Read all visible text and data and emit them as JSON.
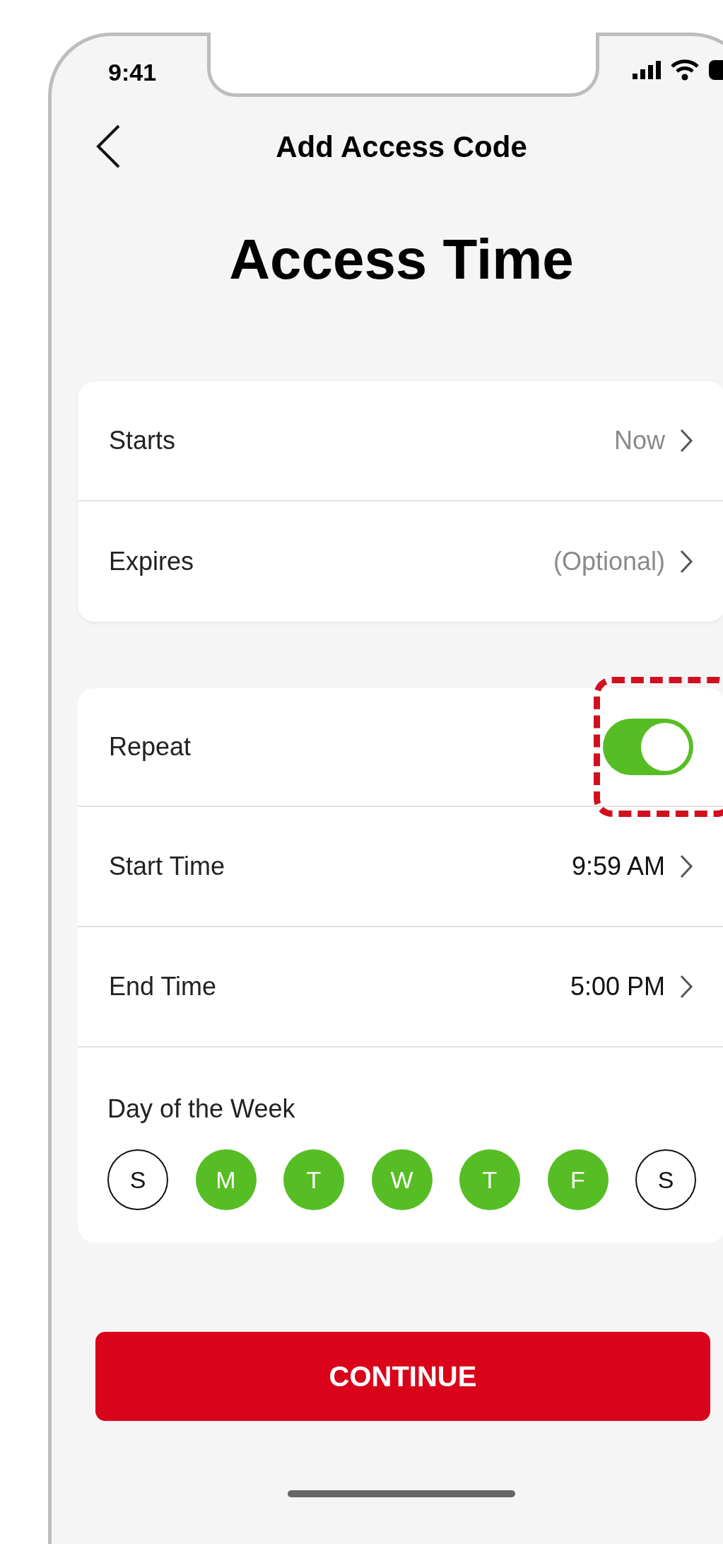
{
  "status_bar": {
    "time": "9:41"
  },
  "header": {
    "title": "Add Access Code"
  },
  "heading": "Access Time",
  "schedule": [
    {
      "label": "Starts",
      "value": "Now",
      "kind": "hint"
    },
    {
      "label": "Expires",
      "value": "(Optional)",
      "kind": "hint"
    }
  ],
  "repeat": {
    "label": "Repeat",
    "on": true
  },
  "times": [
    {
      "label": "Start Time",
      "value": "9:59 AM",
      "kind": "value"
    },
    {
      "label": "End Time",
      "value": "5:00 PM",
      "kind": "value"
    }
  ],
  "days": {
    "label": "Day of the Week",
    "items": [
      {
        "letter": "S",
        "selected": false
      },
      {
        "letter": "M",
        "selected": true
      },
      {
        "letter": "T",
        "selected": true
      },
      {
        "letter": "W",
        "selected": true
      },
      {
        "letter": "T",
        "selected": true
      },
      {
        "letter": "F",
        "selected": true
      },
      {
        "letter": "S",
        "selected": false
      }
    ]
  },
  "button": "CONTINUE"
}
